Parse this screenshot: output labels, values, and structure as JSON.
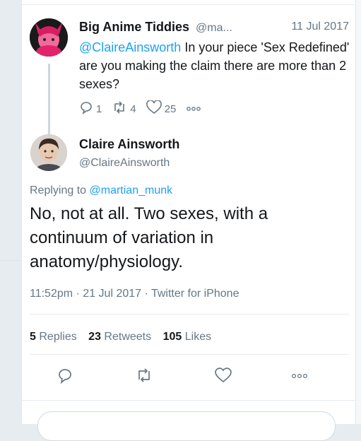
{
  "parent_tweet": {
    "name": "Big Anime Tiddies",
    "handle": "@ma...",
    "date": "11 Jul 2017",
    "mention": "@ClaireAinsworth",
    "text": " In your piece 'Sex Redefined' are you making the claim there are more than 2 sexes?",
    "replies": "1",
    "retweets": "4",
    "likes": "25",
    "icons": [
      "reply-icon",
      "retweet-icon",
      "like-icon",
      "more-icon"
    ]
  },
  "main_tweet": {
    "name": "Claire Ainsworth",
    "handle": "@ClaireAinsworth",
    "replying_prefix": "Replying to ",
    "replying_to": "@martian_munk",
    "text": "No, not at all. Two sexes, with a continuum of variation in anatomy/physiology.",
    "time": "11:52pm · 21 Jul 2017 · Twitter for iPhone",
    "stats": {
      "replies_count": "5",
      "replies_label": "Replies",
      "retweets_count": "23",
      "retweets_label": "Retweets",
      "likes_count": "105",
      "likes_label": "Likes"
    },
    "icons": [
      "reply-icon",
      "retweet-icon",
      "like-icon",
      "more-icon"
    ]
  },
  "colors": {
    "link": "#1da1f2",
    "secondary": "#657786",
    "text": "#14171a"
  }
}
